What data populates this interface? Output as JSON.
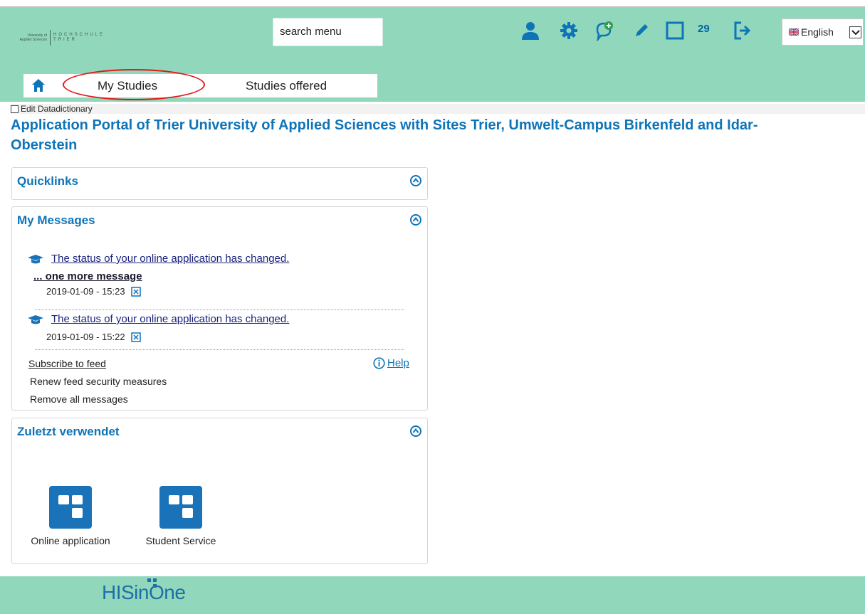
{
  "header": {
    "logo_subtext": "University of Applied Sciences",
    "logo_word": "HOCHSCHULE TRIER",
    "search_text": "search menu",
    "message_count": "29",
    "language": "English",
    "icons": [
      "user-icon",
      "gear-icon",
      "chat-add-icon",
      "pencil-icon",
      "window-icon",
      "logout-icon"
    ]
  },
  "tabs": {
    "my_studies": "My Studies",
    "studies_offered": "Studies offered"
  },
  "edit_datadictionary": "Edit Datadictionary",
  "page_title_line1": "Application Portal of Trier University of Applied Sciences with Sites Trier, Umwelt-Campus Birkenfeld and Idar-",
  "page_title_line2": "Oberstein",
  "panels": {
    "quicklinks": "Quicklinks",
    "messages": "My Messages",
    "recent": "Zuletzt verwendet"
  },
  "messages": [
    {
      "text": "The status of your online application has changed.",
      "more": "... one more message",
      "date": "2019-01-09 - 15:23"
    },
    {
      "text": "The status of your online application has changed.",
      "date": "2019-01-09 - 15:22"
    }
  ],
  "links": {
    "subscribe": "Subscribe to feed",
    "renew": "Renew feed security measures",
    "remove": "Remove all messages",
    "help": "Help"
  },
  "recent_apps": [
    {
      "label": "Online application"
    },
    {
      "label": "Student Service"
    }
  ],
  "footer": {
    "brand": "HISinOne"
  },
  "colors": {
    "header_bg": "#91d7bc",
    "accent_blue": "#0e74b8",
    "icon_blue": "#1a73b8",
    "highlight": "#e11919"
  }
}
